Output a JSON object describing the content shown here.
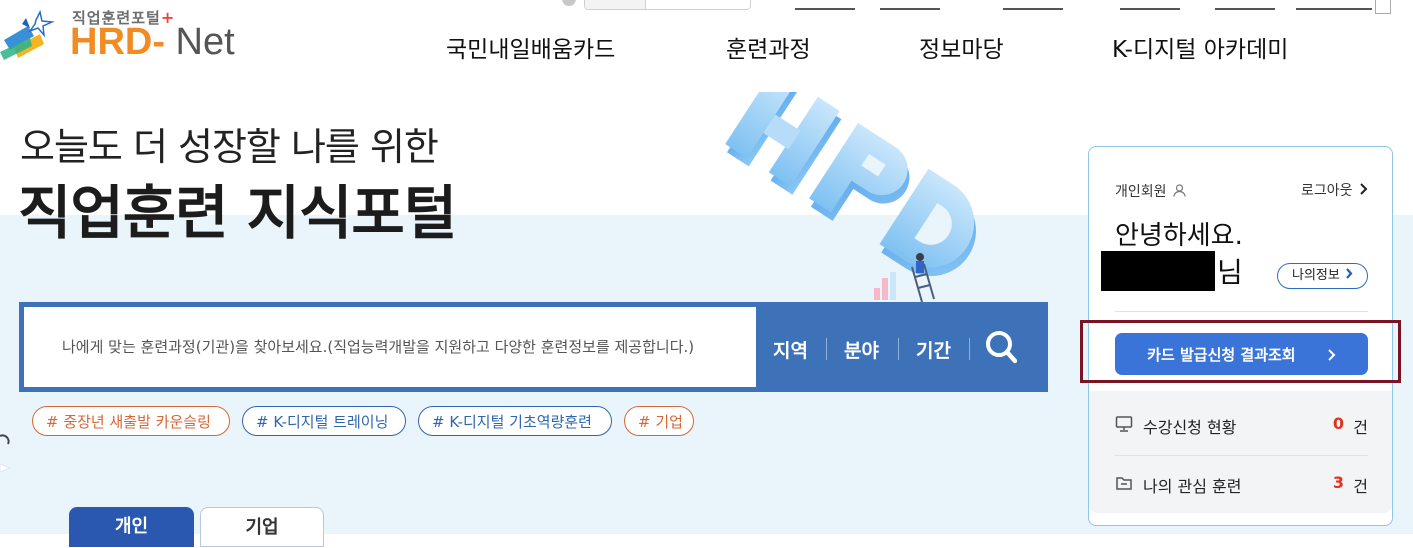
{
  "logo": {
    "small_text": "직업훈련포털",
    "plus": "+",
    "brand": "HRD",
    "dash": "-",
    "suffix": "Net"
  },
  "nav": {
    "items": [
      "국민내일배움카드",
      "훈련과정",
      "정보마당",
      "K-디지털 아카데미"
    ]
  },
  "hero": {
    "subtitle": "오늘도 더 성장할 나를 위한",
    "title": "직업훈련 지식포털"
  },
  "search": {
    "placeholder": "나에게 맞는 훈련과정(기관)을 찾아보세요.(직업능력개발을 지원하고 다양한 훈련정보를 제공합니다.)",
    "filters": [
      "지역",
      "분야",
      "기간"
    ],
    "button_icon": "search-icon"
  },
  "tags": [
    {
      "label": "# 중장년 새출발 카운슬링",
      "color": "#d5683a"
    },
    {
      "label": "# K-디지털 트레이닝",
      "color": "#2e67ad"
    },
    {
      "label": "# K-디지털 기초역량훈련",
      "color": "#2e67ad"
    },
    {
      "label": "# 기업",
      "color": "#d5683a"
    }
  ],
  "tabs": [
    "개인",
    "기업"
  ],
  "member": {
    "type": "개인회원",
    "logout": "로그아웃",
    "greeting": "안녕하세요.",
    "honorific": "님",
    "my_info": "나의정보",
    "card_button": "카드 발급신청 결과조회",
    "stats": [
      {
        "label": "수강신청 현황",
        "count": "0",
        "unit": "건",
        "icon": "monitor-icon"
      },
      {
        "label": "나의 관심 훈련",
        "count": "3",
        "unit": "건",
        "icon": "folder-icon"
      }
    ]
  },
  "colors": {
    "accent": "#3d71b8",
    "primary_button": "#3a74d8",
    "highlight_border": "#7a1425",
    "count": "#e0321d",
    "brand_orange": "#f08c23"
  }
}
